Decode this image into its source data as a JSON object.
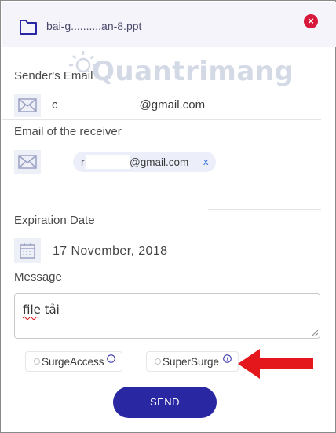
{
  "file": {
    "name": "bai-g..........an-8.ppt"
  },
  "watermark": {
    "text": "Quantrimang"
  },
  "sender": {
    "label": "Sender's Email",
    "value": "c",
    "domain": "@gmail.com"
  },
  "receiver": {
    "label": "Email of the receiver",
    "chip_prefix": "r",
    "chip_domain": "@gmail.com",
    "chip_remove": "x"
  },
  "expiration": {
    "label": "Expiration Date",
    "value": "17 November, 2018"
  },
  "message": {
    "label": "Message",
    "value": "file tải"
  },
  "options": [
    {
      "label": "SurgeAccess",
      "info": "i"
    },
    {
      "label": "SuperSurge",
      "info": "i"
    }
  ],
  "send_label": "SEND",
  "colors": {
    "accent": "#2a27a3",
    "close": "#d7183b",
    "arrow": "#e4181c",
    "icon_bg": "#eef0f7"
  }
}
